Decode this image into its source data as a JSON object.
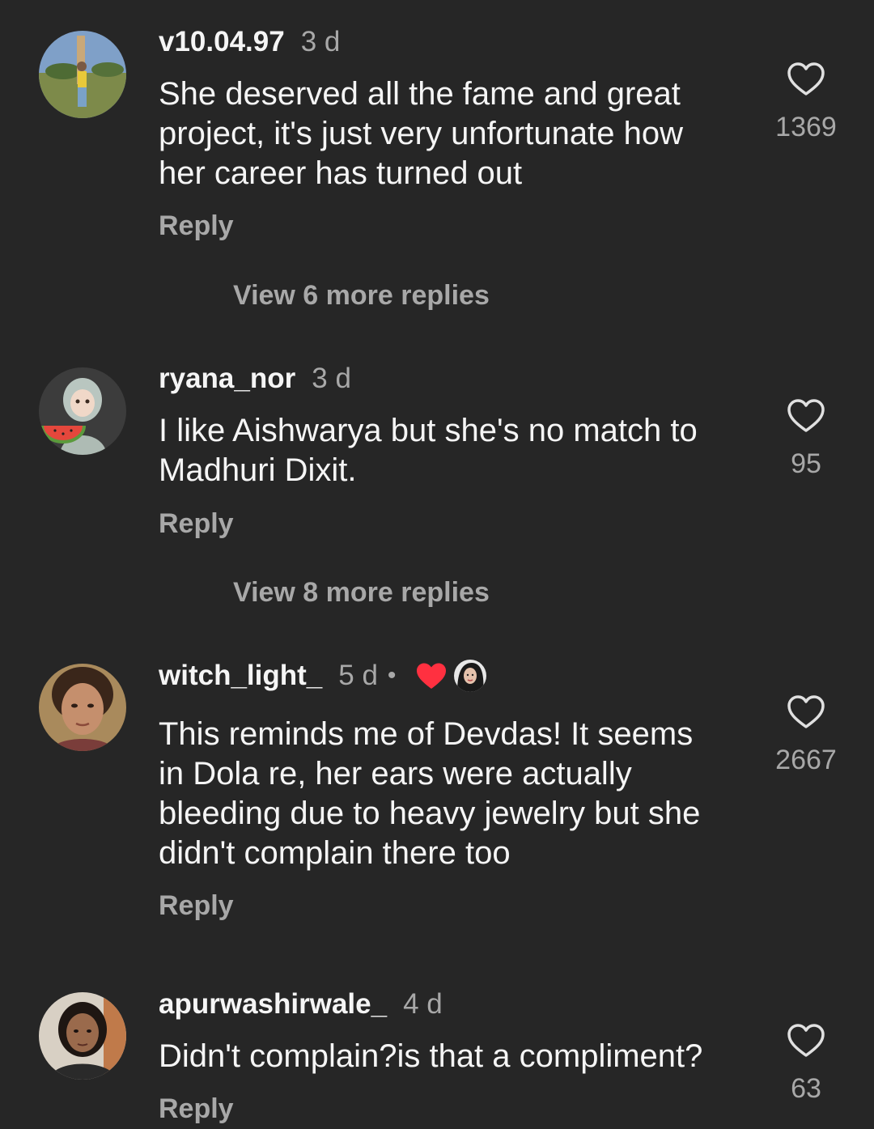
{
  "comments": [
    {
      "username": "v10.04.97",
      "time": "3 d",
      "text": "She deserved all the fame and great\nproject, it's just very unfortunate how\nher career has turned out",
      "reply_label": "Reply",
      "likes": "1369",
      "view_replies": "View 6 more replies"
    },
    {
      "username": "ryana_nor",
      "time": "3 d",
      "text": "I like Aishwarya but she's no match to\nMadhuri Dixit.",
      "reply_label": "Reply",
      "likes": "95",
      "view_replies": "View 8 more replies"
    },
    {
      "username": "witch_light_",
      "time": "5 d",
      "separator": "•",
      "creator_liked": true,
      "text": "This reminds me of Devdas! It seems\nin Dola re, her ears were actually\nbleeding due to heavy jewelry but she\ndidn't complain there too",
      "reply_label": "Reply",
      "likes": "2667"
    },
    {
      "username": "apurwashirwale_",
      "time": "4 d",
      "text": "Didn't complain?is that a compliment?",
      "reply_label": "Reply",
      "likes": "63"
    }
  ],
  "icons": {
    "like": "heart-outline-icon",
    "creator_like": "heart-filled-icon"
  },
  "colors": {
    "background": "#262626",
    "primary_text": "#f5f5f5",
    "secondary_text": "#a8a8a8",
    "creator_heart": "#ff3040"
  }
}
